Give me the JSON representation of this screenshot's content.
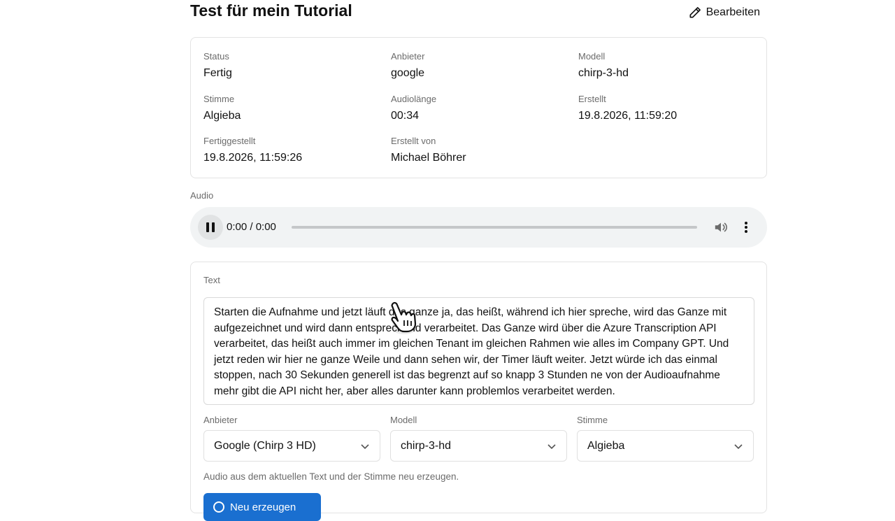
{
  "header": {
    "title": "Test für mein Tutorial",
    "edit_label": "Bearbeiten"
  },
  "info": {
    "status_label": "Status",
    "status_value": "Fertig",
    "provider_label": "Anbieter",
    "provider_value": "google",
    "model_label": "Modell",
    "model_value": "chirp-3-hd",
    "voice_label": "Stimme",
    "voice_value": "Algieba",
    "length_label": "Audiolänge",
    "length_value": "00:34",
    "created_label": "Erstellt",
    "created_value": "19.8.2026, 11:59:20",
    "finished_label": "Fertiggestellt",
    "finished_value": "19.8.2026, 11:59:26",
    "created_by_label": "Erstellt von",
    "created_by_value": "Michael Böhrer"
  },
  "audio": {
    "label": "Audio",
    "time": "0:00 / 0:00",
    "progress": 0
  },
  "text_section": {
    "label": "Text",
    "content": "Starten die Aufnahme und jetzt läuft das ganze ja, das heißt, während ich hier spreche, wird das Ganze mit aufgezeichnet und wird dann entsprechend verarbeitet. Das Ganze wird über die Azure Transcription API verarbeitet, das heißt auch immer im gleichen Tenant im gleichen Rahmen wie alles im Company GPT. Und jetzt reden wir hier ne ganze Weile und dann sehen wir, der Timer läuft weiter. Jetzt würde ich das einmal stoppen, nach 30 Sekunden generell ist das begrenzt auf so knapp 3 Stunden ne von der Audioaufnahme mehr gibt die API nicht her, aber alles darunter kann problemlos verarbeitet werden."
  },
  "selects": {
    "provider_label": "Anbieter",
    "provider_value": "Google (Chirp 3 HD)",
    "model_label": "Modell",
    "model_value": "chirp-3-hd",
    "voice_label": "Stimme",
    "voice_value": "Algieba"
  },
  "hint": "Audio aus dem aktuellen Text und der Stimme neu erzeugen.",
  "regenerate_label": "Neu erzeugen"
}
